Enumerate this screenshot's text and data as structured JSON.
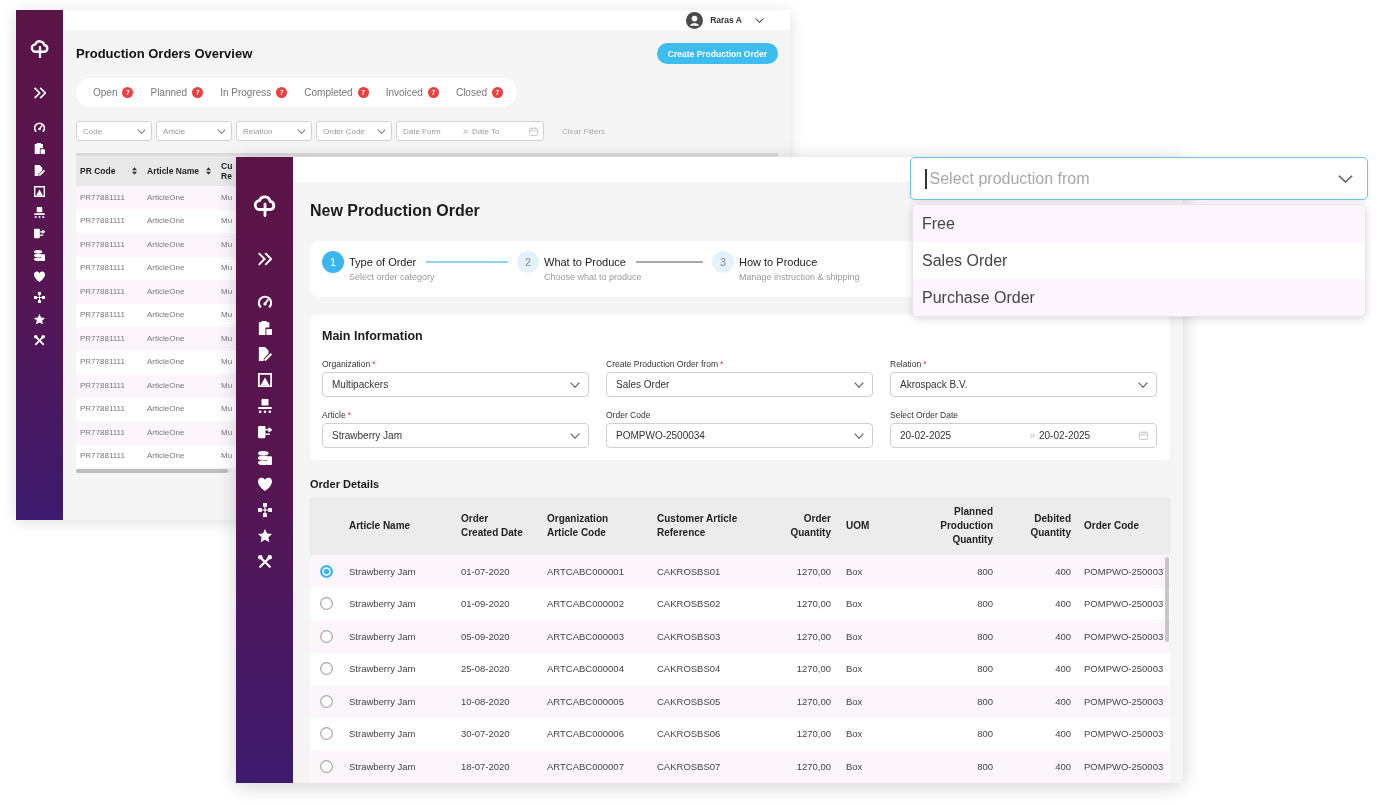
{
  "overview_window": {
    "user_menu": {
      "name": "Raras A"
    },
    "title": "Production Orders Overview",
    "create_button": {
      "label": "Create Production Order"
    },
    "tabs": [
      {
        "label": "Open",
        "count": "7",
        "selected": false
      },
      {
        "label": "Planned",
        "count": "7",
        "selected": false
      },
      {
        "label": "In Progress",
        "count": "7",
        "selected": false
      },
      {
        "label": "Completed",
        "count": "7",
        "selected": false
      },
      {
        "label": "Invoiced",
        "count": "7",
        "selected": false
      },
      {
        "label": "Closed",
        "count": "7",
        "selected": false
      }
    ],
    "filters": [
      {
        "kind": "select",
        "placeholder": "Code"
      },
      {
        "kind": "select",
        "placeholder": "Article"
      },
      {
        "kind": "select",
        "placeholder": "Relation"
      },
      {
        "kind": "select",
        "placeholder": "Order Code"
      },
      {
        "kind": "date_range",
        "from_placeholder": "Date Form",
        "to_placeholder": "Date To"
      }
    ],
    "clear_filters": {
      "label": "Clear Filters",
      "disabled": true
    },
    "table": {
      "columns": [
        {
          "label": "PR Code",
          "sortable": true
        },
        {
          "label": "Article Name",
          "sortable": true
        },
        {
          "label": "Cu Re",
          "sortable": false
        }
      ],
      "rows": [
        [
          "PR77881111",
          "ArticleOne",
          "Mu"
        ],
        [
          "PR77881111",
          "ArticleOne",
          "Mu"
        ],
        [
          "PR77881111",
          "ArticleOne",
          "Mu"
        ],
        [
          "PR77881111",
          "ArticleOne",
          "Mu"
        ],
        [
          "PR77881111",
          "ArticleOne",
          "Mu"
        ],
        [
          "PR77881111",
          "ArticleOne",
          "Mu"
        ],
        [
          "PR77881111",
          "ArticleOne",
          "Mu"
        ],
        [
          "PR77881111",
          "ArticleOne",
          "Mu"
        ],
        [
          "PR77881111",
          "ArticleOne",
          "Mu"
        ],
        [
          "PR77881111",
          "ArticleOne",
          "Mu"
        ],
        [
          "PR77881111",
          "ArticleOne",
          "Mu"
        ],
        [
          "PR77881111",
          "ArticleOne",
          "Mu"
        ]
      ]
    }
  },
  "new_order_window": {
    "title": "New Production Order",
    "steps": [
      {
        "number": "1",
        "title": "Type of Order",
        "subtitle": "Select order category",
        "active": true
      },
      {
        "number": "2",
        "title": "What to Produce",
        "subtitle": "Choose what to produce",
        "active": false
      },
      {
        "number": "3",
        "title": "How to Produce",
        "subtitle": "Manage instruction & shipping",
        "active": false
      }
    ],
    "main_information": {
      "title": "Main Information",
      "fields": [
        {
          "kind": "select",
          "label": "Organization",
          "required_mark": "*",
          "value": "Multipackers"
        },
        {
          "kind": "select",
          "label": "Create Production Order from",
          "required_mark": "*",
          "value": "Sales Order"
        },
        {
          "kind": "select",
          "label": "Relation",
          "required_mark": "*",
          "value": "Akrospack B.V."
        },
        {
          "kind": "select",
          "label": "Article",
          "required_mark": "*",
          "value": "Strawberry Jam"
        },
        {
          "kind": "select",
          "label": "Order Code",
          "value": "POMPWO-2500034"
        },
        {
          "kind": "date_range",
          "label": "Select Order Date",
          "from": "20-02-2025",
          "to": "20-02-2025"
        }
      ]
    },
    "order_details": {
      "title": "Order Details",
      "columns": [
        "Article Name",
        "Order Created Date",
        "Organization Article Code",
        "Customer Article Reference",
        "Order Quantity",
        "UOM",
        "Planned Production Quantity",
        "Debited Quantity",
        "Order Code"
      ],
      "rows": [
        {
          "selected": true,
          "cells": [
            "Strawberry Jam",
            "01-07-2020",
            "ARTCABC000001",
            "CAKROSBS01",
            "1270,00",
            "Box",
            "800",
            "400",
            "POMPWO-250003"
          ]
        },
        {
          "selected": false,
          "cells": [
            "Strawberry Jam",
            "01-09-2020",
            "ARTCABC000002",
            "CAKROSBS02",
            "1270,00",
            "Box",
            "800",
            "400",
            "POMPWO-250003"
          ]
        },
        {
          "selected": false,
          "cells": [
            "Strawberry Jam",
            "05-09-2020",
            "ARTCABC000003",
            "CAKROSBS03",
            "1270,00",
            "Box",
            "800",
            "400",
            "POMPWO-250003"
          ]
        },
        {
          "selected": false,
          "cells": [
            "Strawberry Jam",
            "25-08-2020",
            "ARTCABC000004",
            "CAKROSBS04",
            "1270,00",
            "Box",
            "800",
            "400",
            "POMPWO-250003"
          ]
        },
        {
          "selected": false,
          "cells": [
            "Strawberry Jam",
            "10-08-2020",
            "ARTCABC000005",
            "CAKROSBS05",
            "1270,00",
            "Box",
            "800",
            "400",
            "POMPWO-250003"
          ]
        },
        {
          "selected": false,
          "cells": [
            "Strawberry Jam",
            "30-07-2020",
            "ARTCABC000006",
            "CAKROSBS06",
            "1270,00",
            "Box",
            "800",
            "400",
            "POMPWO-250003"
          ]
        },
        {
          "selected": false,
          "cells": [
            "Strawberry Jam",
            "18-07-2020",
            "ARTCABC000007",
            "CAKROSBS07",
            "1270,00",
            "Box",
            "800",
            "400",
            "POMPWO-250003"
          ]
        }
      ]
    }
  },
  "production_source_dropdown": {
    "placeholder": "Select production from",
    "expanded": true,
    "options": [
      {
        "label": "Free"
      },
      {
        "label": "Sales Order"
      },
      {
        "label": "Purchase Order"
      }
    ]
  }
}
